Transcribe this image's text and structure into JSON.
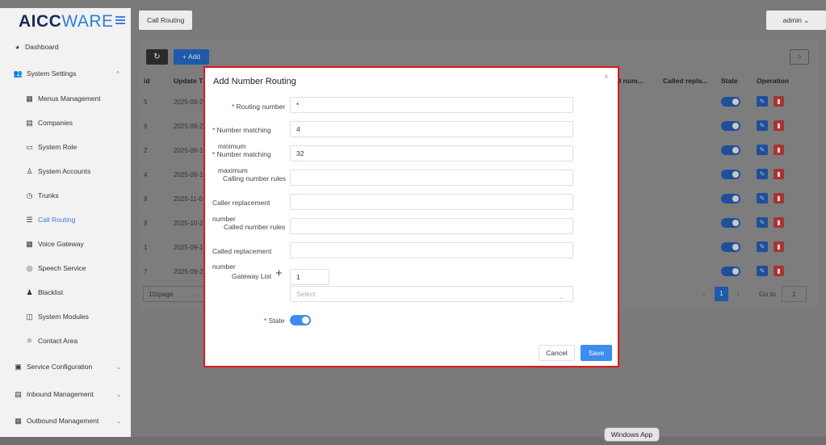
{
  "app": {
    "logo_part1": "AICC",
    "logo_part2": "WARE"
  },
  "sidebar": {
    "items": [
      {
        "label": "Dashboard",
        "icon": "tachometer-icon"
      },
      {
        "label": "System Settings",
        "icon": "users-icon",
        "chevron": "^"
      },
      {
        "label": "Menus Management",
        "icon": "grid-icon"
      },
      {
        "label": "Companies",
        "icon": "table-icon"
      },
      {
        "label": "System Role",
        "icon": "id-card-icon"
      },
      {
        "label": "System Accounts",
        "icon": "user-icon"
      },
      {
        "label": "Trunks",
        "icon": "clock-icon"
      },
      {
        "label": "Call Routing",
        "icon": "list-icon"
      },
      {
        "label": "Voice Gateway",
        "icon": "calendar-icon"
      },
      {
        "label": "Speech Service",
        "icon": "headset-icon"
      },
      {
        "label": "Blacklist",
        "icon": "user-block-icon"
      },
      {
        "label": "System Modules",
        "icon": "module-icon"
      },
      {
        "label": "Contact Area",
        "icon": "location-icon"
      },
      {
        "label": "Service Configuration",
        "icon": "config-icon",
        "chevron": "⌄"
      },
      {
        "label": "Inbound Management",
        "icon": "inbound-icon",
        "chevron": "⌄"
      },
      {
        "label": "Outbound Management",
        "icon": "outbound-icon",
        "chevron": "⌄"
      }
    ]
  },
  "topbar": {
    "tab_label": "Call Routing",
    "user_label": "admin"
  },
  "toolbar": {
    "add_label": "+ Add"
  },
  "table": {
    "headers": [
      "id",
      "Update T",
      "d num...",
      "Called repla...",
      "State",
      "Operation"
    ],
    "rows": [
      {
        "id": "5",
        "update": "2025-09-2"
      },
      {
        "id": "6",
        "update": "2025-09-2"
      },
      {
        "id": "2",
        "update": "2025-09-1"
      },
      {
        "id": "4",
        "update": "2025-09-1"
      },
      {
        "id": "8",
        "update": "2025-11-0"
      },
      {
        "id": "9",
        "update": "2025-10-2"
      },
      {
        "id": "1",
        "update": "2025-09-1"
      },
      {
        "id": "7",
        "update": "2025-09-2"
      }
    ]
  },
  "pagination": {
    "page_size": "10/page",
    "current_page": "1",
    "goto_label": "Go to",
    "goto_value": "1"
  },
  "modal": {
    "title": "Add Number Routing",
    "close": "×",
    "fields": {
      "routing_number": {
        "label": "Routing number",
        "value": "*"
      },
      "num_min": {
        "label1": "Number matching",
        "label2": "minimum",
        "value": "4"
      },
      "num_max": {
        "label1": "Number matching",
        "label2": "maximum",
        "value": "32"
      },
      "calling_rules": {
        "label": "Calling number rules",
        "value": ""
      },
      "caller_repl": {
        "label1": "Caller replacement",
        "label2": "number",
        "value": ""
      },
      "called_rules": {
        "label": "Called number rules",
        "value": ""
      },
      "called_repl": {
        "label1": "Called replacement",
        "label2": "number",
        "value": ""
      },
      "gateway": {
        "label": "Gateway List",
        "count": "1",
        "select_placeholder": "Select"
      },
      "state": {
        "label": "State",
        "on": true
      }
    },
    "cancel_label": "Cancel",
    "save_label": "Save"
  },
  "dock": {
    "tooltip": "Windows App"
  },
  "colors": {
    "accent": "#3d8cf0",
    "highlight_border": "#e0161b",
    "delete": "#a83333"
  }
}
